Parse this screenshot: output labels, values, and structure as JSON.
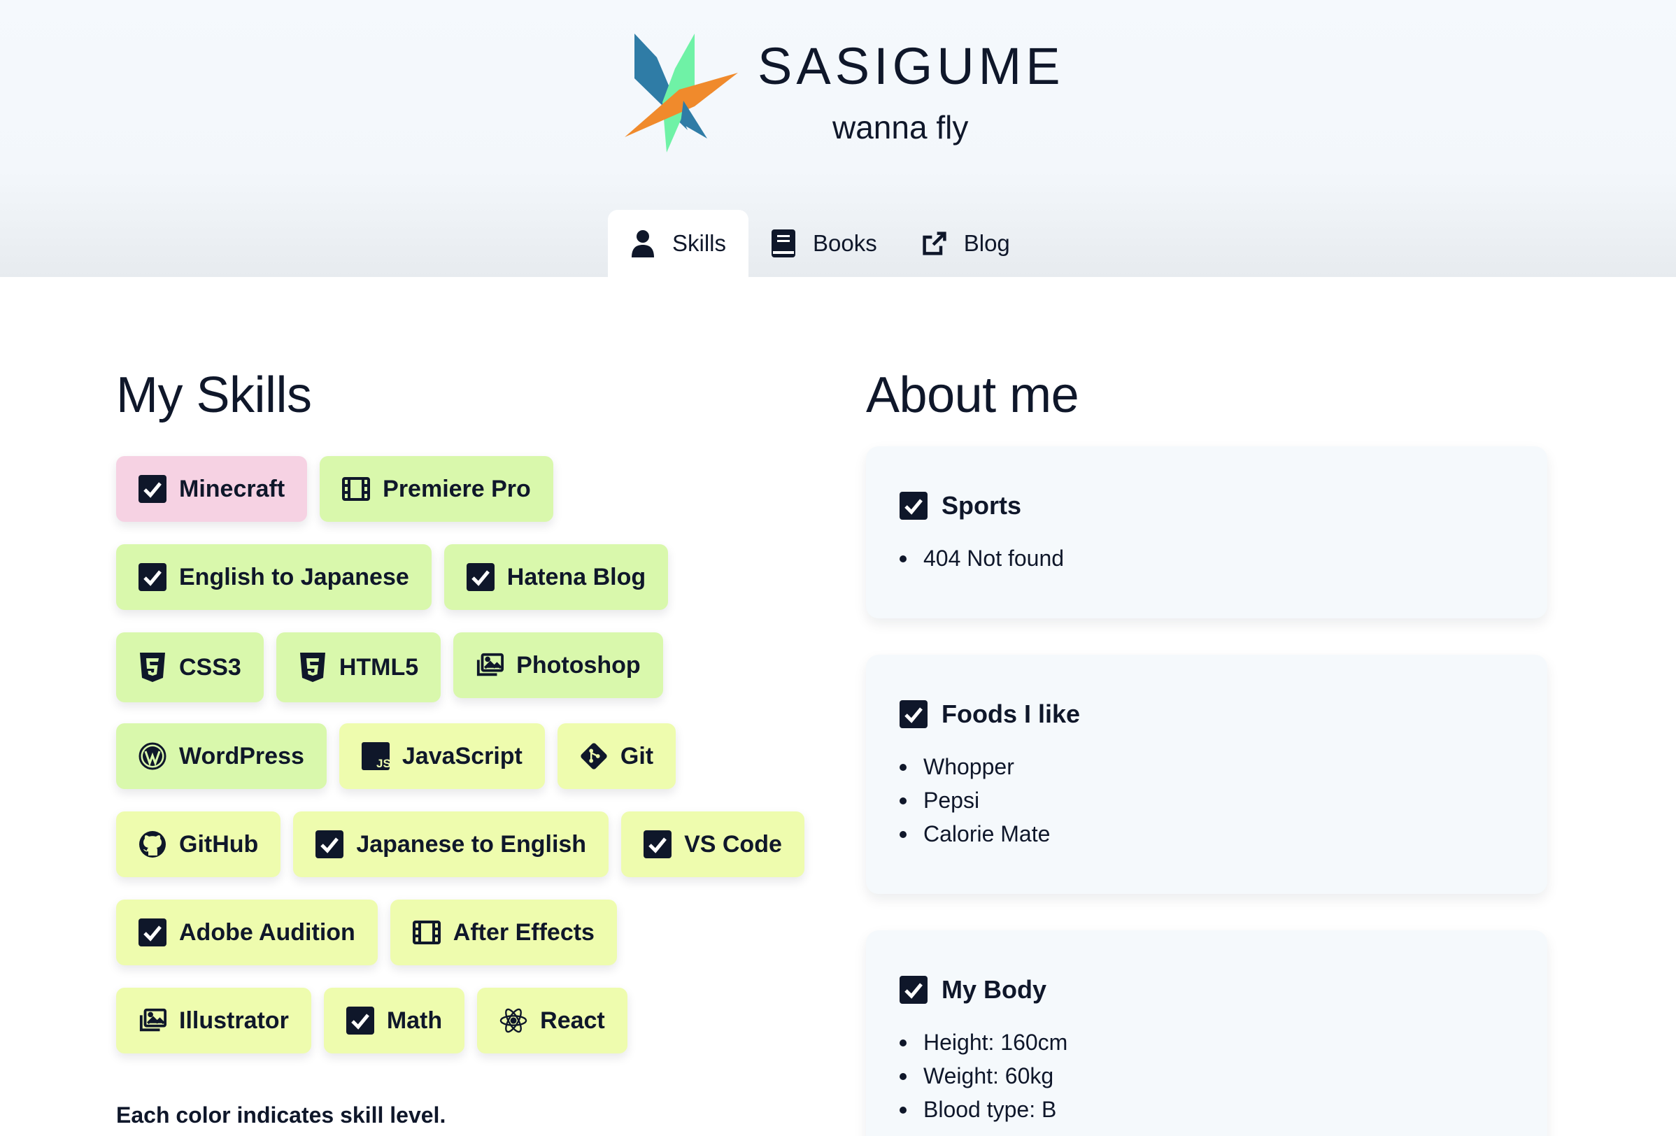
{
  "site": {
    "title": "SASIGUME",
    "subtitle": "wanna fly"
  },
  "nav": {
    "items": [
      {
        "label": "Skills",
        "icon": "user-icon",
        "active": true
      },
      {
        "label": "Books",
        "icon": "book-icon",
        "active": false
      },
      {
        "label": "Blog",
        "icon": "external-link-icon",
        "active": false
      }
    ]
  },
  "skills": {
    "heading": "My Skills",
    "rows": [
      [
        {
          "label": "Minecraft",
          "icon": "checkbox-icon",
          "level": "pink"
        },
        {
          "label": "Premiere Pro",
          "icon": "film-icon",
          "level": "green"
        }
      ],
      [
        {
          "label": "English to Japanese",
          "icon": "checkbox-icon",
          "level": "green"
        },
        {
          "label": "Hatena Blog",
          "icon": "checkbox-icon",
          "level": "green"
        }
      ],
      [
        {
          "label": "CSS3",
          "icon": "css3-icon",
          "level": "green"
        },
        {
          "label": "HTML5",
          "icon": "html5-icon",
          "level": "green"
        },
        {
          "label": "Photoshop",
          "icon": "images-icon",
          "level": "green"
        }
      ],
      [
        {
          "label": "WordPress",
          "icon": "wordpress-icon",
          "level": "green"
        },
        {
          "label": "JavaScript",
          "icon": "javascript-icon",
          "level": "yellow"
        },
        {
          "label": "Git",
          "icon": "git-icon",
          "level": "yellow"
        }
      ],
      [
        {
          "label": "GitHub",
          "icon": "github-icon",
          "level": "yellow"
        },
        {
          "label": "Japanese to English",
          "icon": "checkbox-icon",
          "level": "yellow"
        },
        {
          "label": "VS Code",
          "icon": "checkbox-icon",
          "level": "yellow"
        }
      ],
      [
        {
          "label": "Adobe Audition",
          "icon": "checkbox-icon",
          "level": "yellow"
        },
        {
          "label": "After Effects",
          "icon": "film-icon",
          "level": "yellow"
        }
      ],
      [
        {
          "label": "Illustrator",
          "icon": "images-icon",
          "level": "yellow"
        },
        {
          "label": "Math",
          "icon": "checkbox-icon",
          "level": "yellow"
        },
        {
          "label": "React",
          "icon": "react-icon",
          "level": "yellow"
        }
      ]
    ],
    "note": "Each color indicates skill level."
  },
  "about": {
    "heading": "About me",
    "cards": [
      {
        "title": "Sports",
        "items": [
          "404 Not found"
        ]
      },
      {
        "title": "Foods I like",
        "items": [
          "Whopper",
          "Pepsi",
          "Calorie Mate"
        ]
      },
      {
        "title": "My Body",
        "items": [
          "Height: 160cm",
          "Weight: 60kg",
          "Blood type: B"
        ]
      }
    ]
  },
  "colors": {
    "text": "#0f172a",
    "level_pink": "#f6d2e3",
    "level_green": "#d9f8ac",
    "level_yellow": "#eefcae",
    "card_bg": "#f5f9fc",
    "logo_blue": "#2f7ca6",
    "logo_green": "#6ff2a6",
    "logo_orange": "#f08a2c"
  }
}
